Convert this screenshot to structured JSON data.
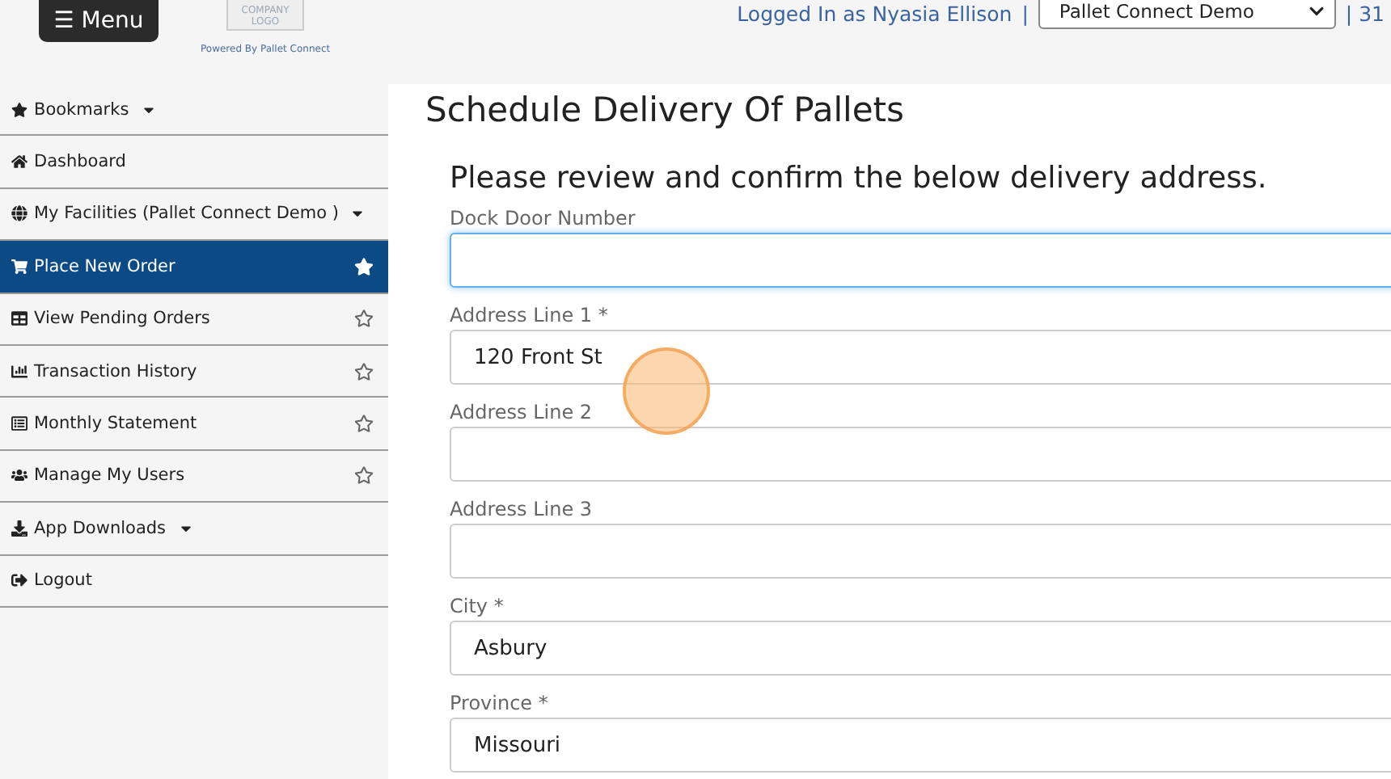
{
  "header": {
    "menu_button": "☰ Menu",
    "logo": [
      "COMPANY",
      "LOGO"
    ],
    "powered_by": "Powered By Pallet Connect",
    "logged_in": "Logged In as Nyasia Ellison",
    "separator": "|",
    "facility_select": "Pallet Connect Demo",
    "trailing": "| 31"
  },
  "sidebar": {
    "items": [
      {
        "label": "Bookmarks",
        "kind": "dropdown",
        "selected": false
      },
      {
        "label": "Dashboard",
        "kind": "link",
        "selected": false
      },
      {
        "label": "My Facilities  (Pallet Connect Demo )",
        "kind": "dropdown",
        "selected": false
      },
      {
        "label": "Place New Order",
        "kind": "page",
        "selected": true,
        "starred": true
      },
      {
        "label": "View Pending Orders",
        "kind": "page",
        "selected": false,
        "starred": false
      },
      {
        "label": "Transaction History",
        "kind": "page",
        "selected": false,
        "starred": false
      },
      {
        "label": "Monthly Statement",
        "kind": "page",
        "selected": false,
        "starred": false
      },
      {
        "label": "Manage My Users",
        "kind": "page",
        "selected": false,
        "starred": false
      },
      {
        "label": "App Downloads",
        "kind": "dropdown",
        "selected": false
      },
      {
        "label": "Logout",
        "kind": "link",
        "selected": false
      }
    ]
  },
  "page_title": "Schedule Delivery Of Pallets",
  "form": {
    "heading": "Please review and confirm the below delivery address.",
    "fields": [
      {
        "label": "Dock Door Number",
        "focused": true
      },
      {
        "label": "Address Line 1 *",
        "value": "120 Front St",
        "focused": false
      },
      {
        "label": "Address Line 2",
        "focused": false
      },
      {
        "label": "Address Line 3",
        "focused": false
      },
      {
        "label": "City *",
        "value": "Asbury",
        "focused": false
      },
      {
        "label": "Province *",
        "value": "Missouri",
        "focused": false
      }
    ]
  }
}
